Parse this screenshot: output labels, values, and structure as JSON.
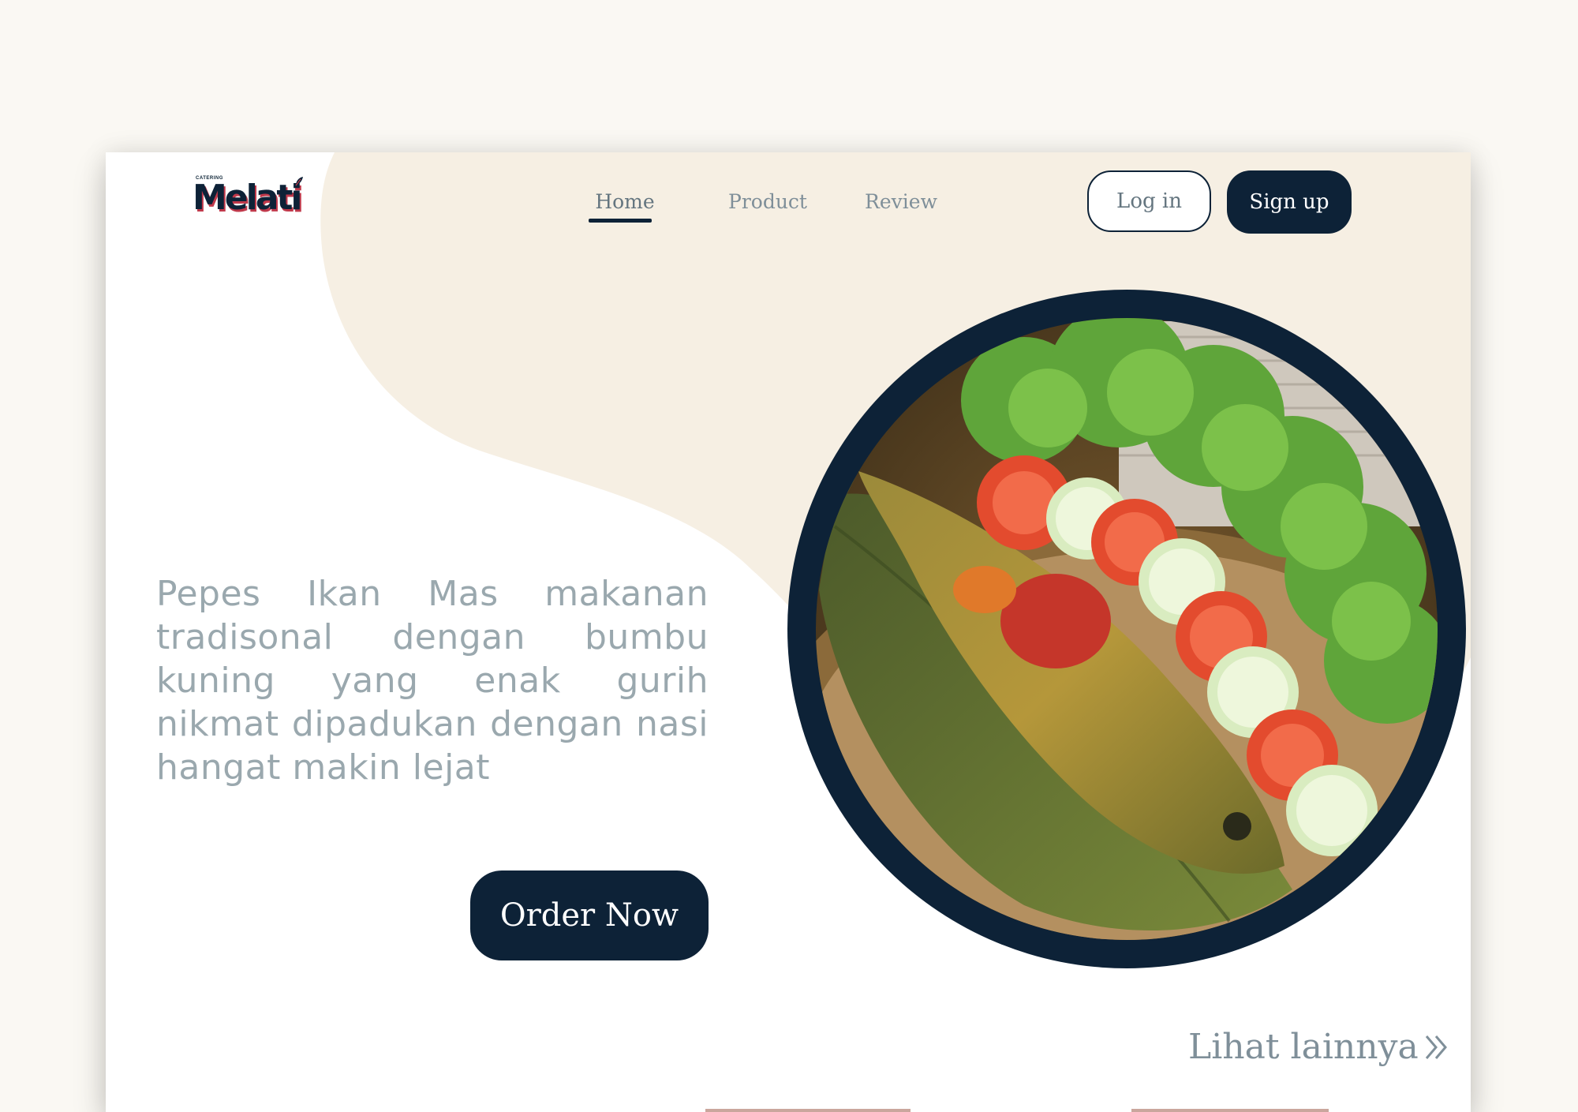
{
  "brand": {
    "small_text": "CATERING",
    "name": "Melati"
  },
  "nav": {
    "items": [
      {
        "label": "Home",
        "active": true
      },
      {
        "label": "Product",
        "active": false
      },
      {
        "label": "Review",
        "active": false
      }
    ]
  },
  "auth": {
    "login_label": "Log in",
    "signup_label": "Sign up"
  },
  "hero": {
    "description": "Pepes Ikan Mas makanan tradisonal dengan bumbu kuning yang enak gurih nikmat dipadukan dengan nasi hangat makin lejat",
    "order_label": "Order Now"
  },
  "more": {
    "label": "Lihat lainnya"
  },
  "icons": {
    "see_more": "double-chevron-right-icon",
    "logo_leaf": "leaf-icon"
  },
  "colors": {
    "navy": "#0d2237",
    "cream": "#f6efe3",
    "text_muted": "#9aa8ae",
    "logo_accent": "#c0394b"
  }
}
